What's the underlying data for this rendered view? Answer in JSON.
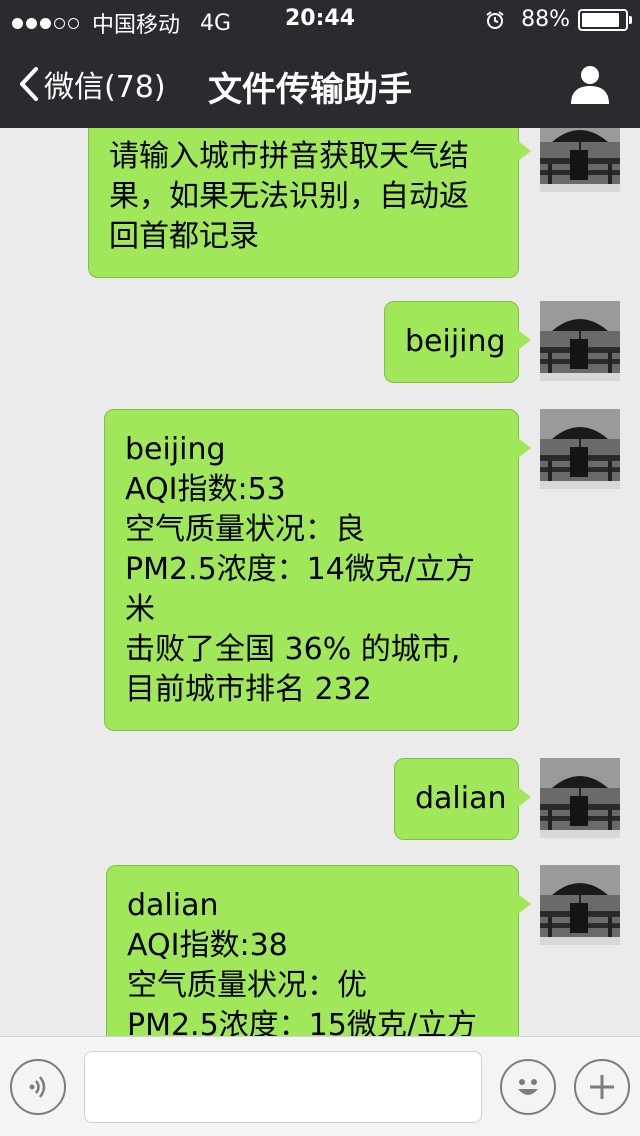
{
  "status_bar": {
    "carrier": "中国移动",
    "network": "4G",
    "time": "20:44",
    "battery_percent": "88%",
    "battery_level": 0.88
  },
  "nav": {
    "back_label": "微信(78)",
    "title": "文件传输助手"
  },
  "messages": [
    {
      "lines": [
        "请输入城市拼音获取天气结",
        "果，如果无法识别，自动返",
        "回首都记录"
      ]
    },
    {
      "lines": [
        "beijing"
      ]
    },
    {
      "lines": [
        "beijing",
        "AQI指数:53",
        "空气质量状况：良",
        "PM2.5浓度：14微克/立方",
        "米",
        "击败了全国 36% 的城市,",
        "目前城市排名 232"
      ]
    },
    {
      "lines": [
        "dalian"
      ]
    },
    {
      "lines": [
        "dalian",
        "AQI指数:38",
        "空气质量状况：优",
        "PM2.5浓度：15微克/立方"
      ]
    }
  ],
  "icons": {
    "back": "chevron-left-icon",
    "profile": "person-icon",
    "voice": "voice-icon",
    "emoji": "smiley-icon",
    "more": "plus-icon",
    "alarm": "alarm-clock-icon"
  },
  "colors": {
    "nav_bg": "#2b2b2f",
    "chat_bg": "#ebebeb",
    "bubble_green": "#a0e75a"
  }
}
